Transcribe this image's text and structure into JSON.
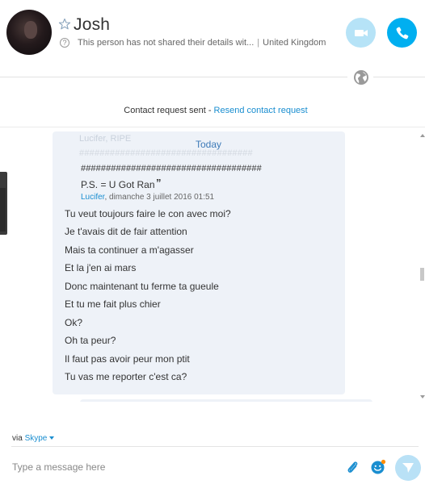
{
  "contact": {
    "name": "Josh",
    "status_text": "This person has not shared their details wit...",
    "location": "United Kingdom"
  },
  "request": {
    "sent_text": "Contact request sent - ",
    "resend_label": "Resend contact request"
  },
  "chat": {
    "ghost_quote_text": "Lucifer,        RIPE",
    "ghost_hash": "##################################",
    "date_divider": "Today",
    "quote": {
      "hash_line": "####################################",
      "text": "P.S. = U Got Ran",
      "author": "Lucifer",
      "timestamp": ", dimanche 3 juillet 2016 01:51"
    },
    "messages": [
      "Tu veut toujours faire le con avec moi?",
      "Je t'avais dit de fair attention",
      "Mais ta continuer a m'agasser",
      "Et la j'en ai mars",
      "Donc maintenant tu ferme ta gueule",
      "Et tu me fait plus chier",
      "Ok?",
      "Oh ta peur?",
      "Il faut pas avoir peur mon ptit",
      "Tu vas me reporter c'est ca?"
    ]
  },
  "composer": {
    "via_label": "via ",
    "via_service": "Skype",
    "placeholder": "Type a message here"
  },
  "icons": {
    "star": "star-icon",
    "info": "info-icon",
    "video": "video-camera-icon",
    "call": "phone-icon",
    "globe": "globe-icon",
    "attach": "paperclip-icon",
    "emoticon": "smiley-icon",
    "send": "send-icon"
  },
  "colors": {
    "accent": "#00aff0",
    "accent_light": "#b6e3f7",
    "link": "#1a8ed0",
    "bubble_bg": "#eef2f8",
    "date_divider": "#3d7ab8"
  }
}
